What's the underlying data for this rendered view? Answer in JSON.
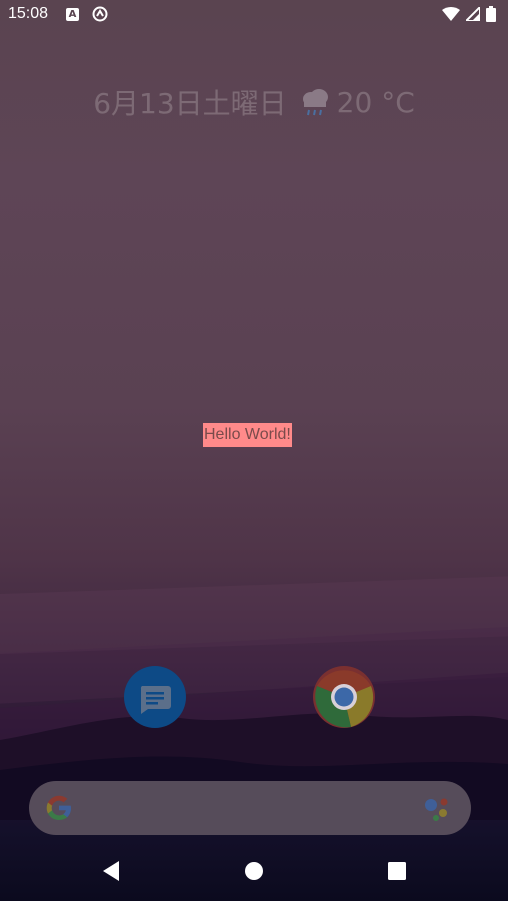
{
  "status_bar": {
    "time": "15:08",
    "notification_a": "A",
    "icons": [
      "notification-a-icon",
      "sync-icon",
      "wifi-icon",
      "signal-icon",
      "battery-icon"
    ]
  },
  "glance": {
    "date": "6月13日土曜日",
    "temperature": "20 °C",
    "weather_icon": "rain-cloud-icon"
  },
  "content": {
    "hello_text": "Hello World!"
  },
  "dock": {
    "apps": [
      {
        "name": "messages",
        "icon": "messages-icon"
      },
      {
        "name": "chrome",
        "icon": "chrome-icon"
      }
    ]
  },
  "search": {
    "icon": "google-g-icon",
    "assistant_icon": "google-assistant-icon"
  },
  "nav": {
    "buttons": [
      "back-icon",
      "home-icon",
      "recents-icon"
    ]
  },
  "colors": {
    "hello_bg": "#ff8a8a",
    "messages_bg": "#0d4a86"
  }
}
